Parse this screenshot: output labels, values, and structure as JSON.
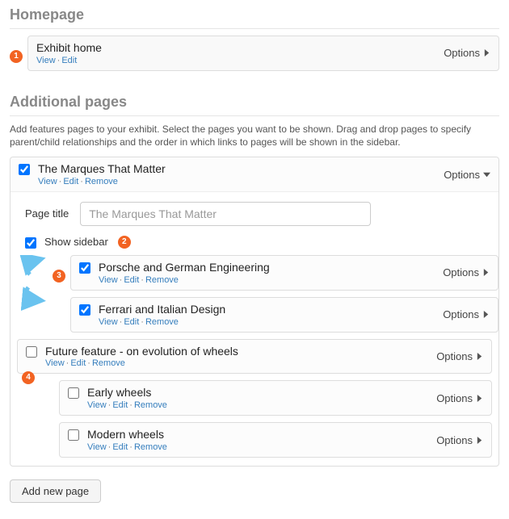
{
  "sections": {
    "homepage_heading": "Homepage",
    "additional_heading": "Additional pages",
    "description": "Add features pages to your exhibit. Select the pages you want to be shown. Drag and drop pages to specify parent/child relationships and the order in which links to pages will be shown in the sidebar."
  },
  "home": {
    "title": "Exhibit home",
    "view": "View",
    "edit": "Edit",
    "options": "Options"
  },
  "top": {
    "title": "The Marques That Matter",
    "page_title_label": "Page title",
    "page_title_value": "The Marques That Matter",
    "show_sidebar_label": "Show sidebar"
  },
  "children": {
    "porsche": "Porsche and German Engineering",
    "ferrari": "Ferrari and Italian Design",
    "future": "Future feature - on evolution of wheels",
    "early": "Early wheels",
    "modern": "Modern wheels"
  },
  "links": {
    "view": "View",
    "edit": "Edit",
    "remove": "Remove"
  },
  "options_label": "Options",
  "add_button": "Add new page",
  "bullets": {
    "b1": "1",
    "b2": "2",
    "b3": "3",
    "b4": "4"
  }
}
